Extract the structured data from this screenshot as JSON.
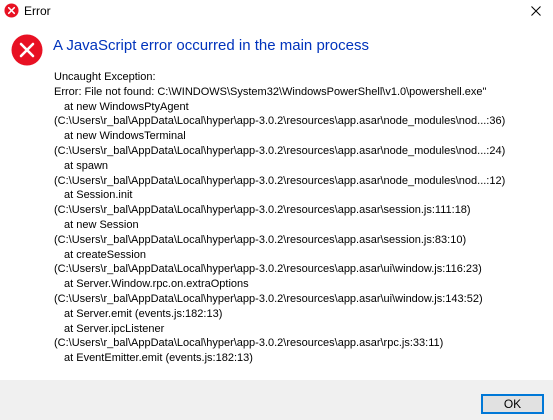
{
  "window": {
    "title": "Error",
    "icon": "error-icon"
  },
  "dialog": {
    "heading": "A JavaScript error occurred in the main process",
    "icon": "error-icon",
    "accent_color": "#0033bc",
    "error_color": "#e81123",
    "lines": [
      {
        "text": "Uncaught Exception:",
        "indent": false
      },
      {
        "text": "Error: File not found: C:\\WINDOWS\\System32\\WindowsPowerShell\\v1.0\\powershell.exe\"",
        "indent": false
      },
      {
        "text": "at new WindowsPtyAgent",
        "indent": true
      },
      {
        "text": "(C:\\Users\\r_bal\\AppData\\Local\\hyper\\app-3.0.2\\resources\\app.asar\\node_modules\\nod...:36)",
        "indent": false
      },
      {
        "text": "at new WindowsTerminal",
        "indent": true
      },
      {
        "text": "(C:\\Users\\r_bal\\AppData\\Local\\hyper\\app-3.0.2\\resources\\app.asar\\node_modules\\nod...:24)",
        "indent": false
      },
      {
        "text": "at spawn",
        "indent": true
      },
      {
        "text": "(C:\\Users\\r_bal\\AppData\\Local\\hyper\\app-3.0.2\\resources\\app.asar\\node_modules\\nod...:12)",
        "indent": false
      },
      {
        "text": "at Session.init",
        "indent": true
      },
      {
        "text": "(C:\\Users\\r_bal\\AppData\\Local\\hyper\\app-3.0.2\\resources\\app.asar\\session.js:111:18)",
        "indent": false
      },
      {
        "text": "at new Session",
        "indent": true
      },
      {
        "text": "(C:\\Users\\r_bal\\AppData\\Local\\hyper\\app-3.0.2\\resources\\app.asar\\session.js:83:10)",
        "indent": false
      },
      {
        "text": "at createSession",
        "indent": true
      },
      {
        "text": "(C:\\Users\\r_bal\\AppData\\Local\\hyper\\app-3.0.2\\resources\\app.asar\\ui\\window.js:116:23)",
        "indent": false
      },
      {
        "text": "at Server.Window.rpc.on.extraOptions",
        "indent": true
      },
      {
        "text": "(C:\\Users\\r_bal\\AppData\\Local\\hyper\\app-3.0.2\\resources\\app.asar\\ui\\window.js:143:52)",
        "indent": false
      },
      {
        "text": "at Server.emit (events.js:182:13)",
        "indent": true
      },
      {
        "text": "at Server.ipcListener",
        "indent": true
      },
      {
        "text": "(C:\\Users\\r_bal\\AppData\\Local\\hyper\\app-3.0.2\\resources\\app.asar\\rpc.js:33:11)",
        "indent": false
      },
      {
        "text": "at EventEmitter.emit (events.js:182:13)",
        "indent": true
      }
    ]
  },
  "buttons": {
    "ok_label": "OK"
  }
}
